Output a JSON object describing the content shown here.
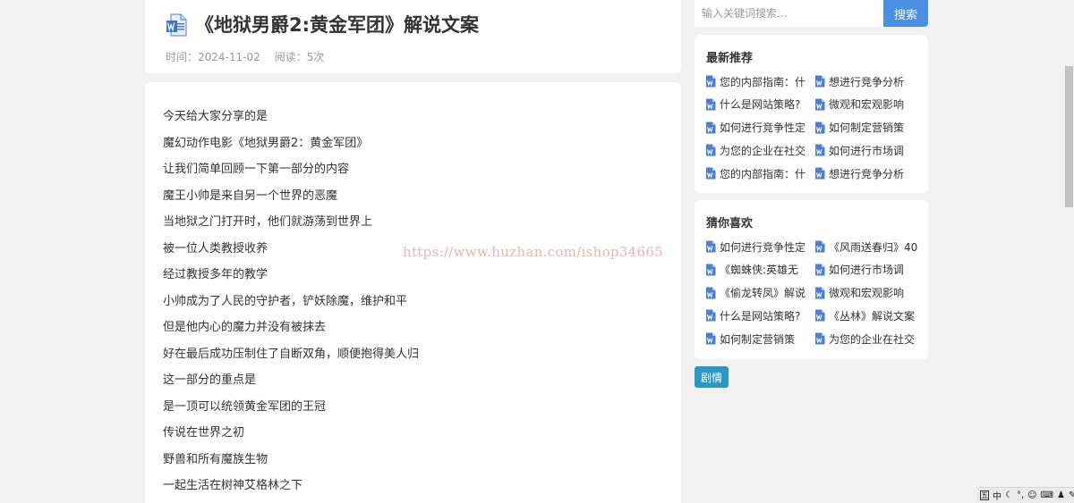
{
  "article": {
    "title": "《地狱男爵2:黄金军团》解说文案",
    "meta_time": "时间：2024-11-02",
    "meta_reads": "阅读：5次",
    "lines": [
      "今天给大家分享的是",
      "魔幻动作电影《地狱男爵2：黄金军团》",
      "让我们简单回顾一下第一部分的内容",
      "魔王小帅是来自另一个世界的恶魔",
      "当地狱之门打开时，他们就游荡到世界上",
      "被一位人类教授收养",
      "经过教授多年的教学",
      "小帅成为了人民的守护者，铲妖除魔，维护和平",
      "但是他内心的魔力并没有被抹去",
      "好在最后成功压制住了自断双角，顺便抱得美人归",
      "这一部分的重点是",
      "是一顶可以统领黄金军团的王冠",
      "传说在世界之初",
      "野兽和所有魔族生物",
      "一起生活在树神艾格林之下"
    ],
    "watermark": "https://www.huzhan.com/ishop34665"
  },
  "search": {
    "placeholder": "输入关键词搜索...",
    "button_label": "搜索"
  },
  "recommended": {
    "title": "最新推荐",
    "items": [
      "您的内部指南：什",
      "想进行竞争分析",
      "什么是网站策略?",
      "微观和宏观影响",
      "如何进行竞争性定",
      "如何制定营销策",
      "为您的企业在社交",
      "如何进行市场调",
      "您的内部指南：什",
      "想进行竞争分析"
    ]
  },
  "guess_like": {
    "title": "猜你喜欢",
    "items": [
      "如何进行竞争性定",
      "《风雨送春归》40",
      "《蜘蛛侠:英雄无",
      "如何进行市场调",
      "《偷龙转凤》解说",
      "微观和宏观影响",
      "什么是网站策略?",
      "《丛林》解说文案",
      "如何制定营销策",
      "为您的企业在社交"
    ]
  },
  "tag": {
    "label": "剧情"
  },
  "tray": {
    "ime_label": "中"
  },
  "colors": {
    "accent": "#4a90e2",
    "tag": "#2b97c4",
    "word_icon": "#4a7fd8",
    "background": "#f1f1f1"
  }
}
